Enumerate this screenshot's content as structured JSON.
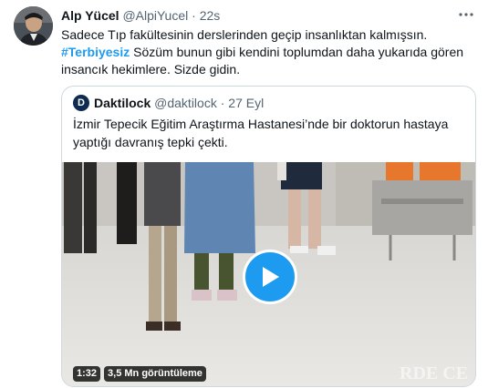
{
  "tweet": {
    "author_name": "Alp Yücel",
    "author_handle": "@AlpiYucel",
    "separator": "·",
    "time": "22s",
    "text_line1": "Sadece Tıp fakültesinin derslerinden geçip insanlıktan kalmışsın.",
    "hashtag": "#Terbiyesiz",
    "text_after_hashtag": " Sözüm bunun gibi kendini toplumdan daha yukarıda gören insancık hekimlere. Sizde gidin."
  },
  "quote": {
    "avatar_letter": "D",
    "author_name": "Daktilock",
    "author_handle": "@daktilock",
    "separator": "·",
    "time": "27 Eyl",
    "text": "İzmir Tepecik Eğitim Araştırma Hastanesi’nde bir doktorun hastaya yaptığı davranış tepki çekti.",
    "video": {
      "duration": "1:32",
      "views": "3,5 Mn görüntüleme"
    }
  },
  "colors": {
    "accent": "#1d9bf0",
    "text": "#0f1419",
    "muted": "#536471",
    "border": "#cfd9de"
  },
  "icons": {
    "more": "more-options-icon",
    "play": "play-icon"
  }
}
